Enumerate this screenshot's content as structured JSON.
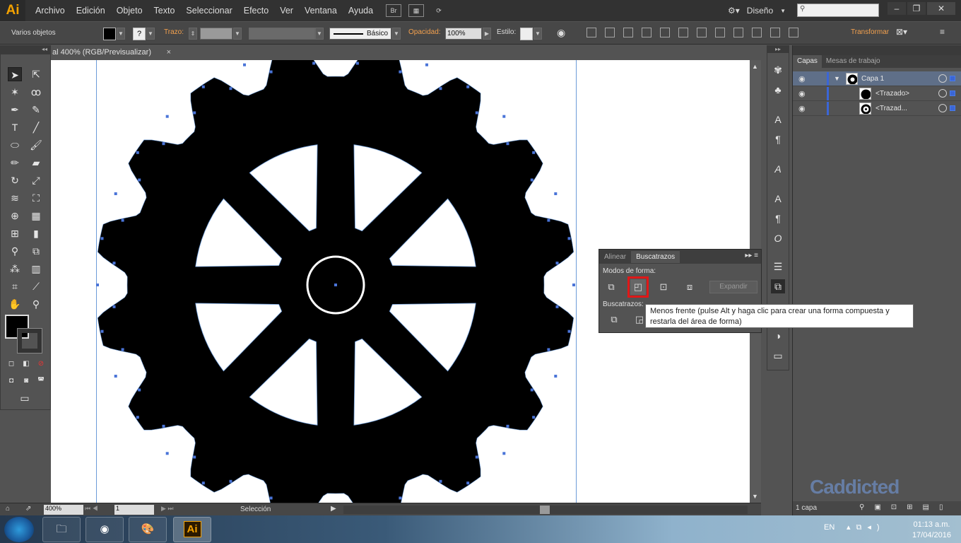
{
  "app": {
    "logo": "Ai"
  },
  "menu": [
    "Archivo",
    "Edición",
    "Objeto",
    "Texto",
    "Seleccionar",
    "Efecto",
    "Ver",
    "Ventana",
    "Ayuda"
  ],
  "menubar": {
    "bridge": "Br",
    "workspace": "Diseño"
  },
  "control": {
    "selection": "Varios objetos",
    "stroke_label": "Trazo:",
    "brush": "Básico",
    "opacity_label": "Opacidad:",
    "opacity_value": "100%",
    "style_label": "Estilo:",
    "transform": "Transformar"
  },
  "document": {
    "tab_title": "al 400% (RGB/Previsualizar)",
    "close": "×"
  },
  "status": {
    "zoom": "400%",
    "page": "1",
    "mode": "Selección"
  },
  "pathfinder": {
    "tabs": [
      "Alinear",
      "Buscatrazos"
    ],
    "shape_modes_label": "Modos de forma:",
    "pathfinders_label": "Buscatrazos:",
    "expand": "Expandir",
    "tooltip": "Menos frente (pulse Alt y haga clic para crear una forma compuesta y restarla del área de forma)"
  },
  "layers": {
    "tabs": [
      "Capas",
      "Mesas de trabajo"
    ],
    "rows": [
      {
        "name": "Capa 1"
      },
      {
        "name": "<Trazado>"
      },
      {
        "name": "<Trazad..."
      }
    ],
    "count": "1 capa"
  },
  "watermark": "Caddicted",
  "taskbar": {
    "lang": "EN",
    "time": "01:13 a.m.",
    "date": "17/04/2016"
  },
  "colors": {
    "accent_orange": "#f2a04e",
    "selection_blue": "#3b66d6",
    "highlight_red": "#e01818",
    "fill": "#000000"
  }
}
